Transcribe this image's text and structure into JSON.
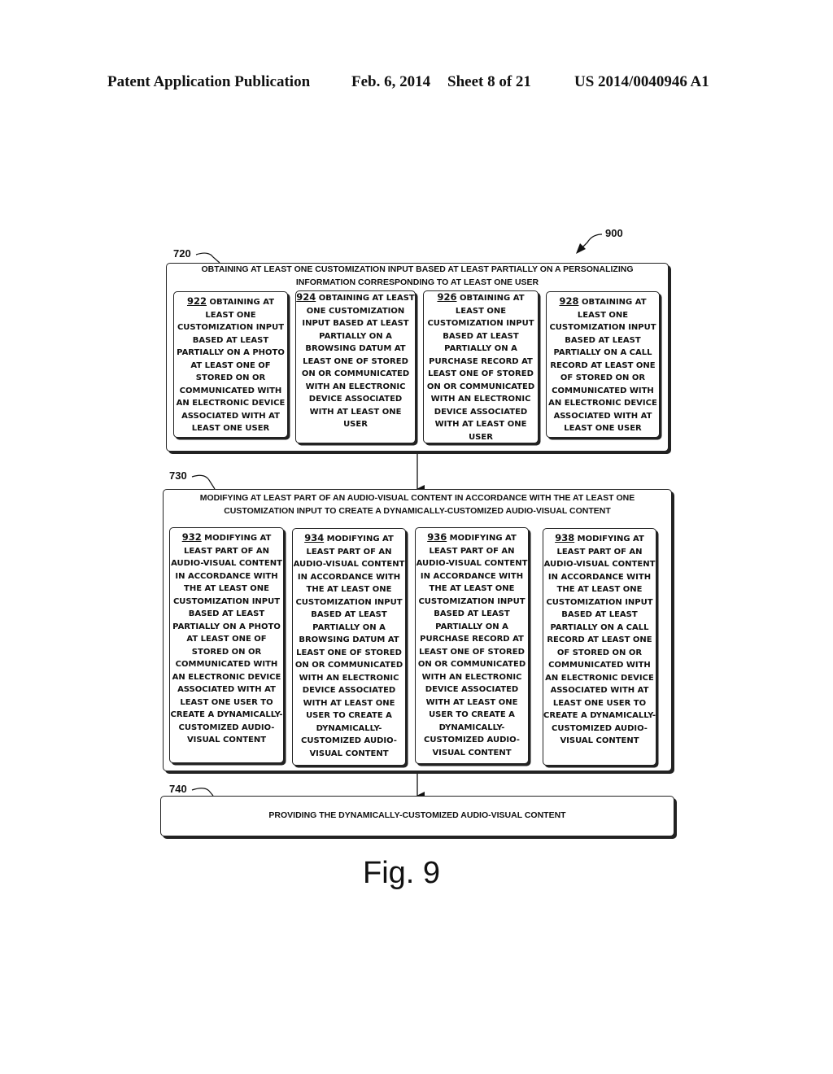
{
  "header": {
    "publication": "Patent Application Publication",
    "date": "Feb. 6, 2014",
    "sheet": "Sheet 8 of 21",
    "patent_number": "US 2014/0040946 A1"
  },
  "figure_ref": "900",
  "blocks": {
    "b720": {
      "ref": "720",
      "title": "OBTAINING AT LEAST ONE CUSTOMIZATION INPUT BASED AT LEAST PARTIALLY ON A PERSONALIZING INFORMATION CORRESPONDING TO AT LEAST ONE USER",
      "subs": [
        {
          "num": "922",
          "text": " OBTAINING AT LEAST ONE CUSTOMIZATION INPUT BASED AT LEAST PARTIALLY ON A PHOTO AT LEAST ONE OF STORED ON OR COMMUNICATED WITH AN ELECTRONIC DEVICE ASSOCIATED WITH AT LEAST ONE USER"
        },
        {
          "num": "924",
          "text": " OBTAINING AT LEAST ONE CUSTOMIZATION INPUT BASED AT LEAST PARTIALLY ON A BROWSING DATUM AT LEAST ONE OF STORED ON OR COMMUNICATED WITH AN ELECTRONIC DEVICE ASSOCIATED WITH AT LEAST ONE USER"
        },
        {
          "num": "926",
          "text": " OBTAINING AT LEAST ONE CUSTOMIZATION INPUT BASED AT LEAST PARTIALLY ON A PURCHASE RECORD AT LEAST ONE OF STORED ON OR COMMUNICATED WITH AN ELECTRONIC DEVICE ASSOCIATED WITH AT LEAST ONE USER"
        },
        {
          "num": "928",
          "text": " OBTAINING AT LEAST ONE CUSTOMIZATION INPUT BASED AT LEAST PARTIALLY ON A CALL RECORD AT LEAST ONE OF STORED ON OR COMMUNICATED WITH AN ELECTRONIC DEVICE ASSOCIATED WITH AT LEAST ONE USER"
        }
      ]
    },
    "b730": {
      "ref": "730",
      "title": "MODIFYING AT LEAST PART OF AN AUDIO-VISUAL CONTENT IN ACCORDANCE WITH THE AT LEAST ONE CUSTOMIZATION INPUT TO CREATE A DYNAMICALLY-CUSTOMIZED AUDIO-VISUAL CONTENT",
      "subs": [
        {
          "num": "932",
          "text": " MODIFYING AT LEAST PART OF AN AUDIO-VISUAL CONTENT IN ACCORDANCE WITH THE AT LEAST ONE CUSTOMIZATION INPUT BASED AT LEAST PARTIALLY ON A PHOTO AT LEAST ONE OF STORED ON OR COMMUNICATED WITH AN ELECTRONIC DEVICE ASSOCIATED WITH AT LEAST ONE USER TO CREATE A DYNAMICALLY-CUSTOMIZED AUDIO-VISUAL CONTENT"
        },
        {
          "num": "934",
          "text": " MODIFYING AT LEAST PART OF AN AUDIO-VISUAL CONTENT IN ACCORDANCE WITH THE AT LEAST ONE CUSTOMIZATION INPUT BASED AT LEAST PARTIALLY ON A BROWSING DATUM AT LEAST ONE OF STORED ON OR COMMUNICATED WITH AN ELECTRONIC DEVICE ASSOCIATED WITH AT LEAST ONE USER TO CREATE A DYNAMICALLY-CUSTOMIZED AUDIO-VISUAL CONTENT"
        },
        {
          "num": "936",
          "text": " MODIFYING AT LEAST PART OF AN AUDIO-VISUAL CONTENT IN ACCORDANCE WITH THE AT LEAST ONE CUSTOMIZATION INPUT BASED AT LEAST PARTIALLY ON A PURCHASE RECORD AT LEAST ONE OF STORED ON OR COMMUNICATED WITH AN ELECTRONIC DEVICE ASSOCIATED WITH AT LEAST ONE USER TO CREATE A DYNAMICALLY-CUSTOMIZED AUDIO-VISUAL CONTENT"
        },
        {
          "num": "938",
          "text": " MODIFYING AT LEAST PART OF AN AUDIO-VISUAL CONTENT IN ACCORDANCE WITH THE AT LEAST ONE CUSTOMIZATION INPUT BASED AT LEAST PARTIALLY ON A CALL RECORD AT LEAST ONE OF STORED ON OR COMMUNICATED WITH AN ELECTRONIC DEVICE ASSOCIATED WITH AT LEAST ONE USER TO CREATE A DYNAMICALLY-CUSTOMIZED AUDIO-VISUAL CONTENT"
        }
      ]
    },
    "b740": {
      "ref": "740",
      "title": "PROVIDING THE DYNAMICALLY-CUSTOMIZED AUDIO-VISUAL CONTENT"
    }
  },
  "figure_label": "Fig. 9"
}
